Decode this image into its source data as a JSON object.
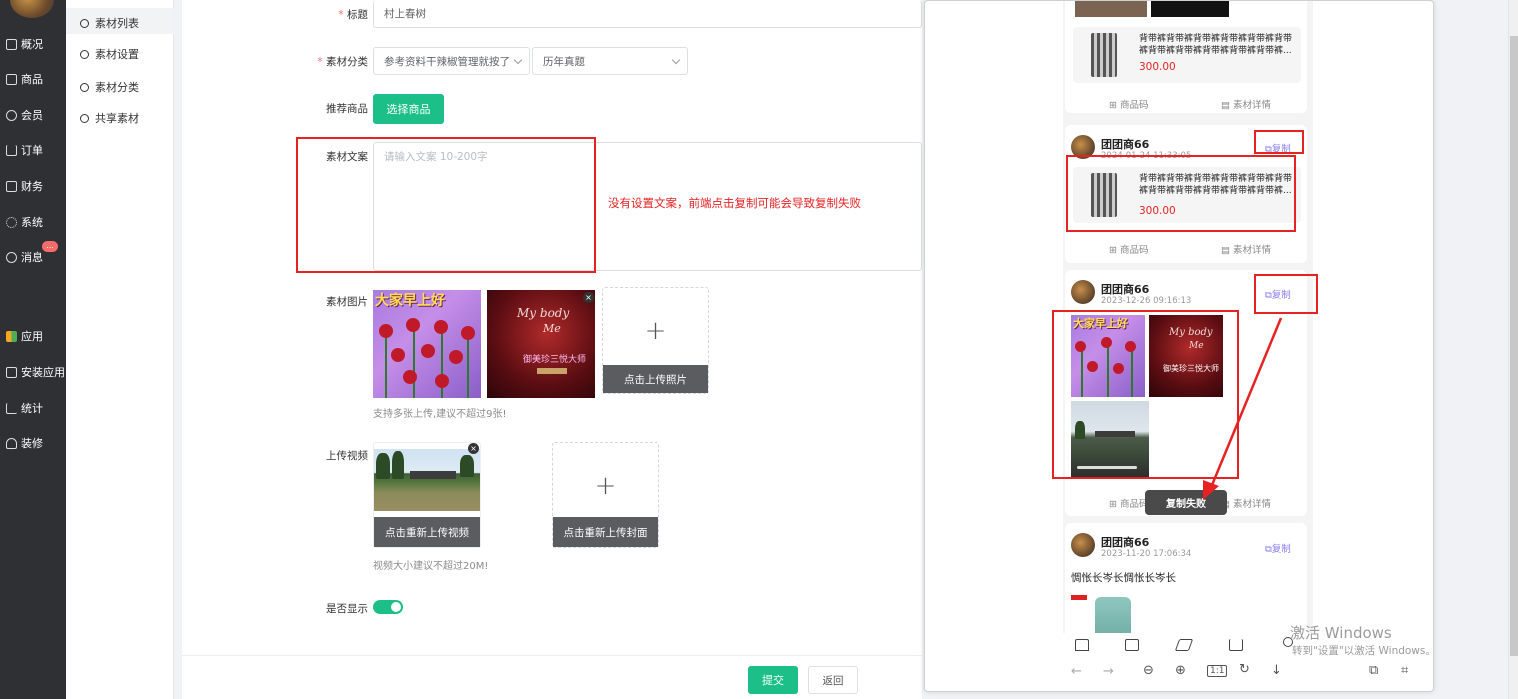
{
  "sidebar": {
    "items": [
      {
        "label": "概况",
        "icon": "dashboard-icon"
      },
      {
        "label": "商品",
        "icon": "goods-icon"
      },
      {
        "label": "会员",
        "icon": "members-icon"
      },
      {
        "label": "订单",
        "icon": "cart-icon"
      },
      {
        "label": "财务",
        "icon": "finance-icon"
      },
      {
        "label": "系统",
        "icon": "gear-icon"
      },
      {
        "label": "消息",
        "icon": "message-icon"
      },
      {
        "label": "应用",
        "icon": "apps-icon"
      },
      {
        "label": "安装应用",
        "icon": "install-icon"
      },
      {
        "label": "统计",
        "icon": "chart-icon"
      },
      {
        "label": "装修",
        "icon": "brush-icon"
      }
    ],
    "message_badge": "..."
  },
  "submenu": {
    "items": [
      "素材列表",
      "素材设置",
      "素材分类",
      "共享素材"
    ]
  },
  "form": {
    "title_label": "标题",
    "title_value": "村上春树",
    "category_label": "素材分类",
    "category_primary": "参考资料干辣椒管理就按了",
    "category_secondary": "历年真题",
    "recommend_label": "推荐商品",
    "select_goods_button": "选择商品",
    "copy_text_label": "素材文案",
    "copy_text_placeholder": "请输入文案 10-200字",
    "images_label": "素材图片",
    "upload_photo_button": "点击上传照片",
    "images_hint": "支持多张上传,建议不超过9张!",
    "video_label": "上传视频",
    "reupload_video_button": "点击重新上传视频",
    "reupload_cover_button": "点击重新上传封面",
    "video_hint": "视频大小建议不超过20M!",
    "show_label": "是否显示",
    "show_enabled": true
  },
  "annotation": {
    "note": "没有设置文案，前端点击复制可能会导致复制失败",
    "color": "#e62222"
  },
  "footer": {
    "submit": "提交",
    "back": "返回"
  },
  "image_texts": {
    "roses_title": "大家早上好",
    "dark_line1": "My body",
    "dark_line2": "Me",
    "dark_caption": "御美珍三悦大师"
  },
  "preview": {
    "goods_title": "背带裤背带裤背带裤背带裤背带裤背带裤背带裤背带裤背带裤背带裤背带裤...",
    "goods_price": "300.00",
    "goods_code": "商品码",
    "material_detail": "素材详情",
    "copy": "复制",
    "copy_failed_toast": "复制失败",
    "posts": [
      {
        "user": "团团商66",
        "time": "2024-01-24 11:33:05"
      },
      {
        "user": "团团商66",
        "time": "2023-12-26 09:16:13"
      },
      {
        "user": "团团商66",
        "time": "2023-11-20 17:06:34",
        "text": "惆怅长岑长惆怅长岑长"
      }
    ]
  },
  "watermark": {
    "line1": "激活 Windows",
    "line2": "转到\"设置\"以激活 Windows。"
  },
  "colors": {
    "primary_green": "#1dbf88",
    "sidebar_bg": "#2f3033",
    "price_red": "#e62222",
    "copy_purple": "#8b7cf0"
  }
}
